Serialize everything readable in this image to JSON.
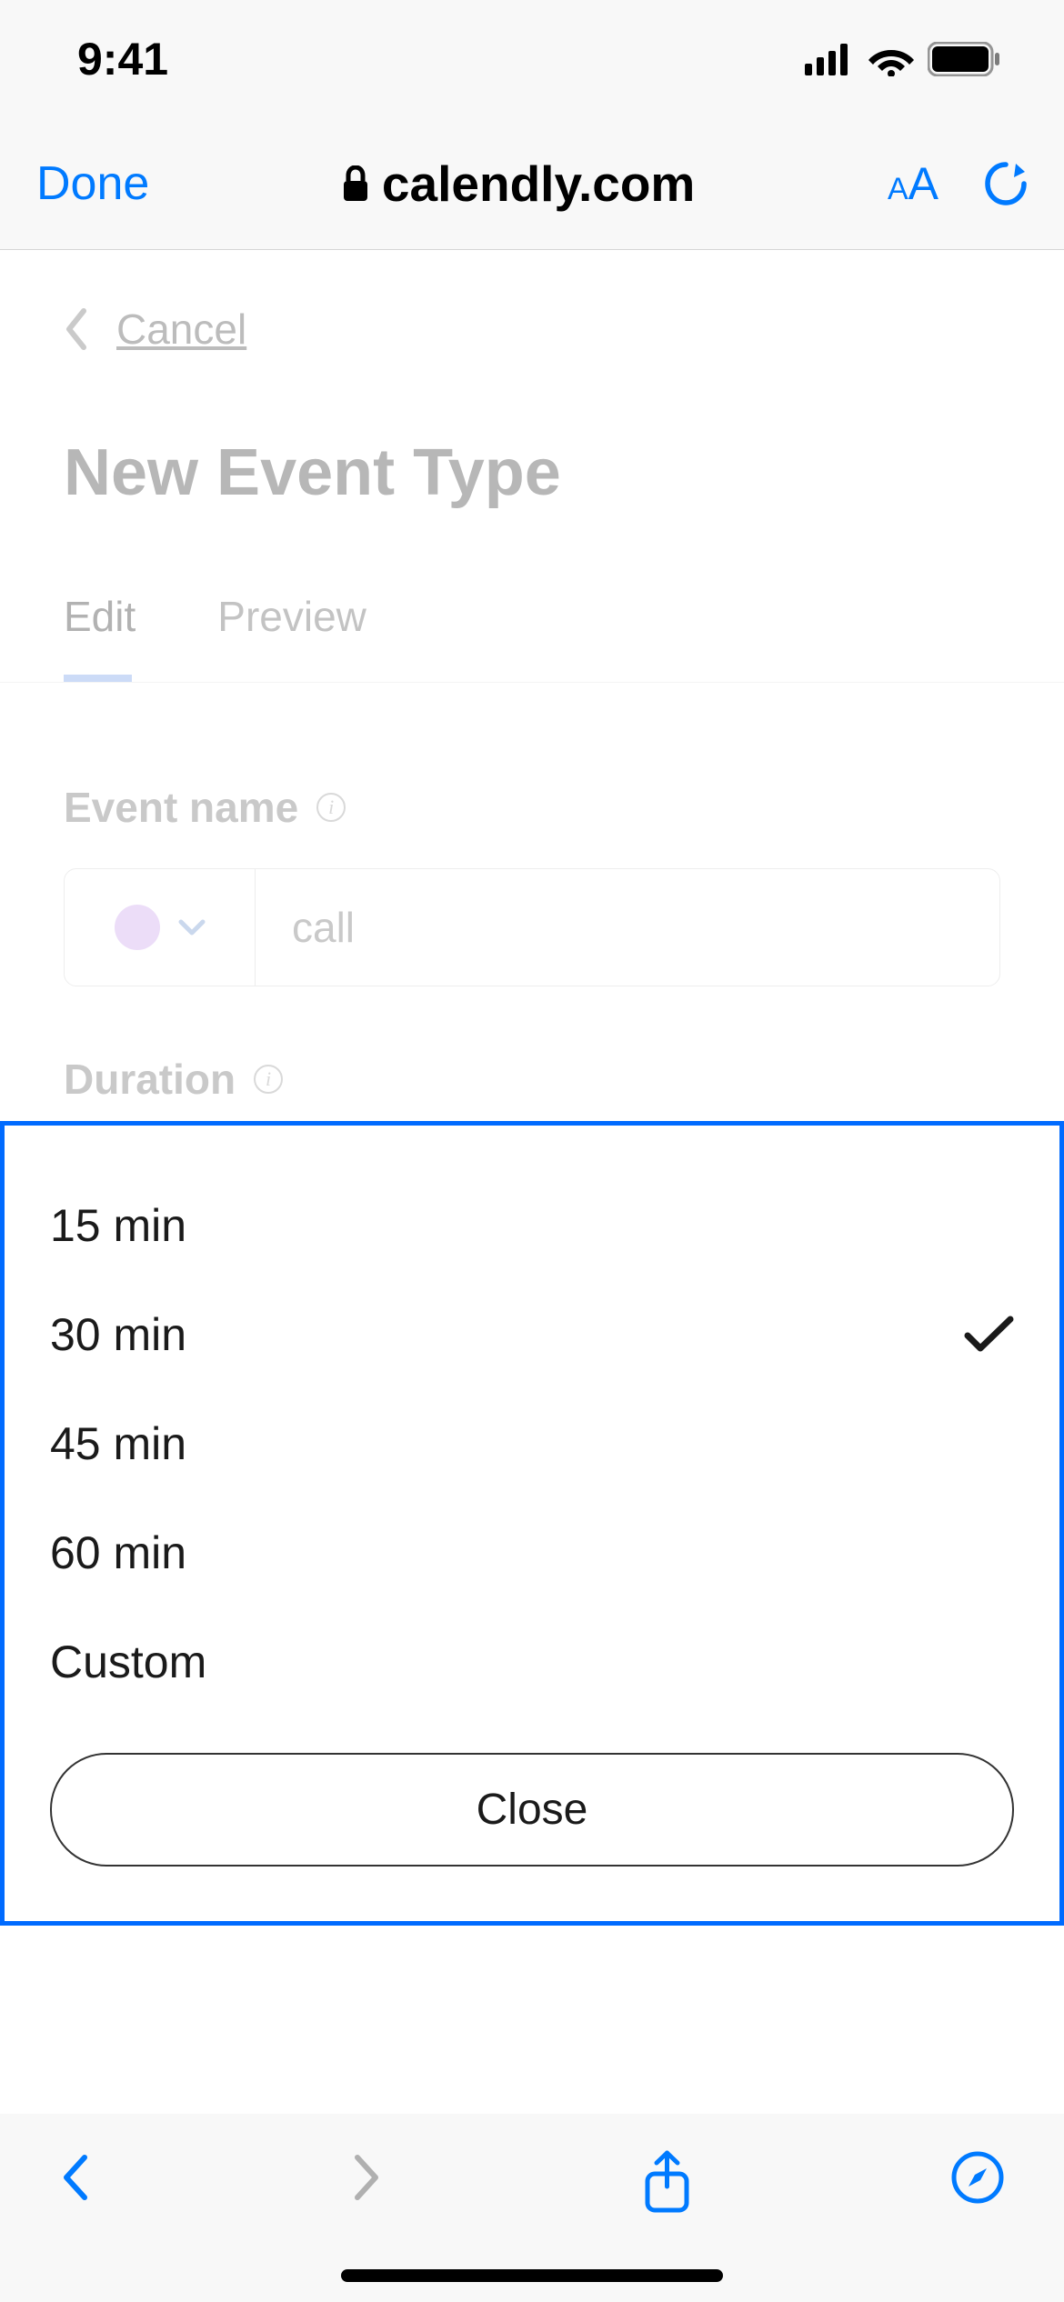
{
  "status_bar": {
    "time": "9:41"
  },
  "browser": {
    "done_label": "Done",
    "domain": "calendly.com"
  },
  "page": {
    "cancel_label": "Cancel",
    "title": "New Event Type",
    "tabs": {
      "edit": "Edit",
      "preview": "Preview"
    },
    "fields": {
      "event_name": {
        "label": "Event name",
        "value": "call",
        "color": "#d4b3ef"
      },
      "duration": {
        "label": "Duration",
        "selected": "30 min"
      }
    }
  },
  "picker": {
    "options": [
      {
        "label": "15 min",
        "selected": false
      },
      {
        "label": "30 min",
        "selected": true
      },
      {
        "label": "45 min",
        "selected": false
      },
      {
        "label": "60 min",
        "selected": false
      },
      {
        "label": "Custom",
        "selected": false
      }
    ],
    "close_label": "Close"
  }
}
